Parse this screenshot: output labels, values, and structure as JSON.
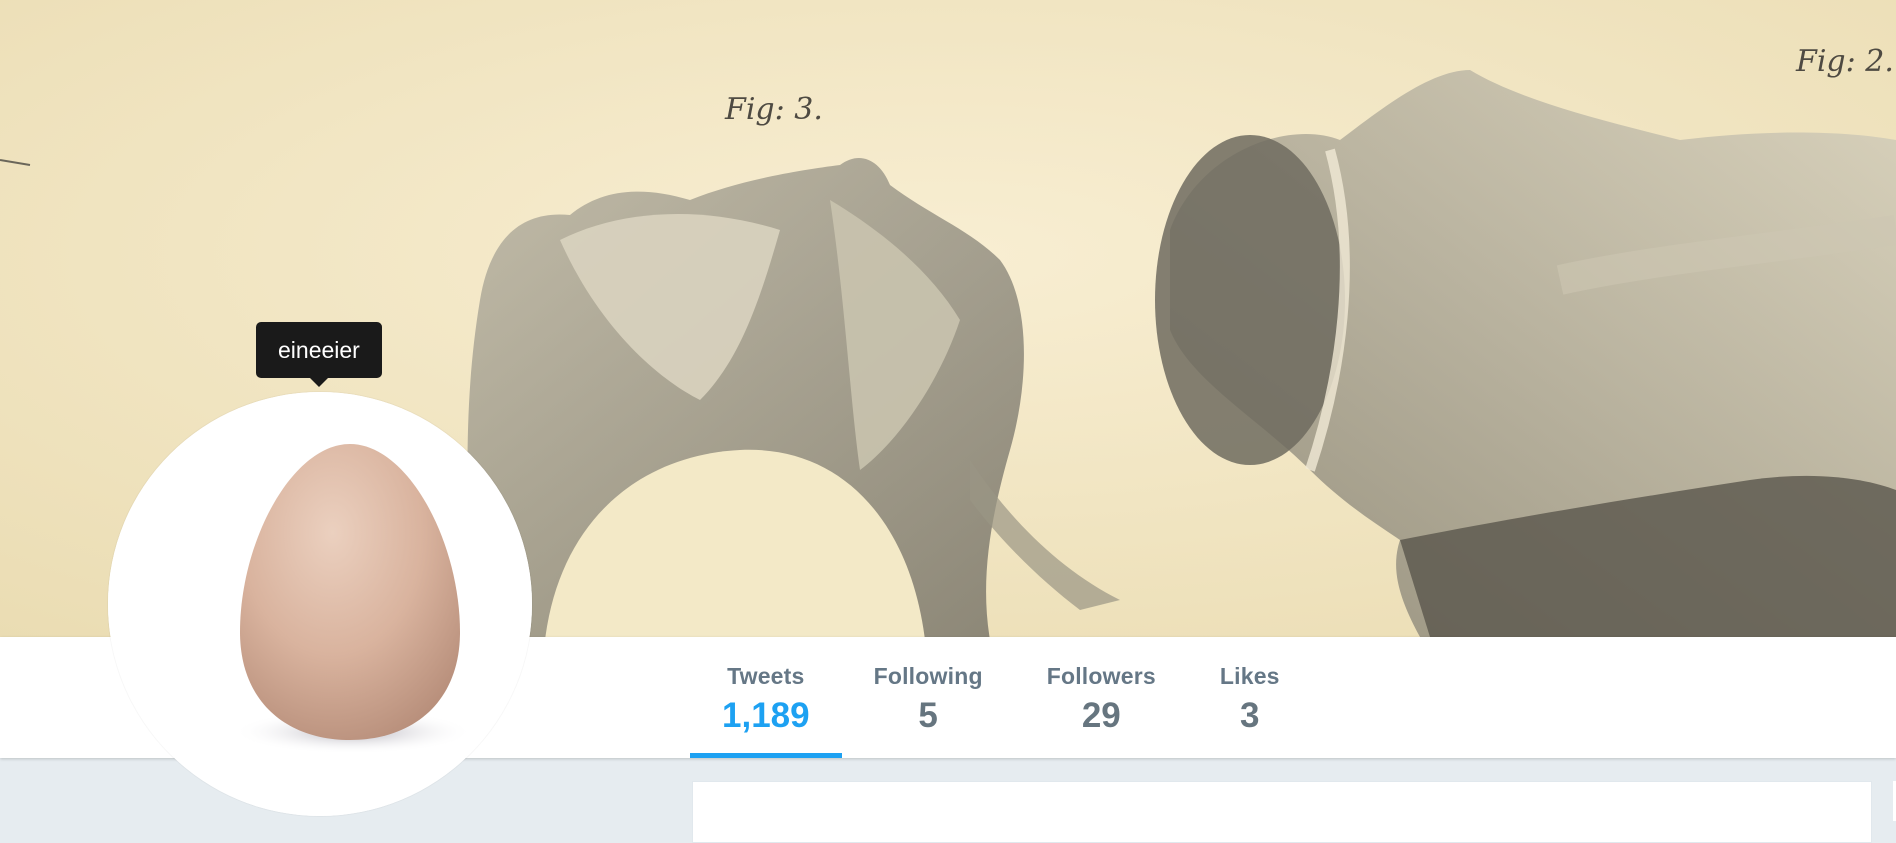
{
  "profile": {
    "screen_name_tooltip": "eineeier"
  },
  "banner": {
    "fig_labels": [
      "Fig: 3.",
      "Fig: 2."
    ]
  },
  "nav": {
    "stats": [
      {
        "label": "Tweets",
        "value": "1,189",
        "active": true
      },
      {
        "label": "Following",
        "value": "5",
        "active": false
      },
      {
        "label": "Followers",
        "value": "29",
        "active": false
      },
      {
        "label": "Likes",
        "value": "3",
        "active": false
      }
    ]
  },
  "colors": {
    "accent": "#1da1f2",
    "stat_text": "#657786",
    "page_bg": "#e6ecf0"
  }
}
